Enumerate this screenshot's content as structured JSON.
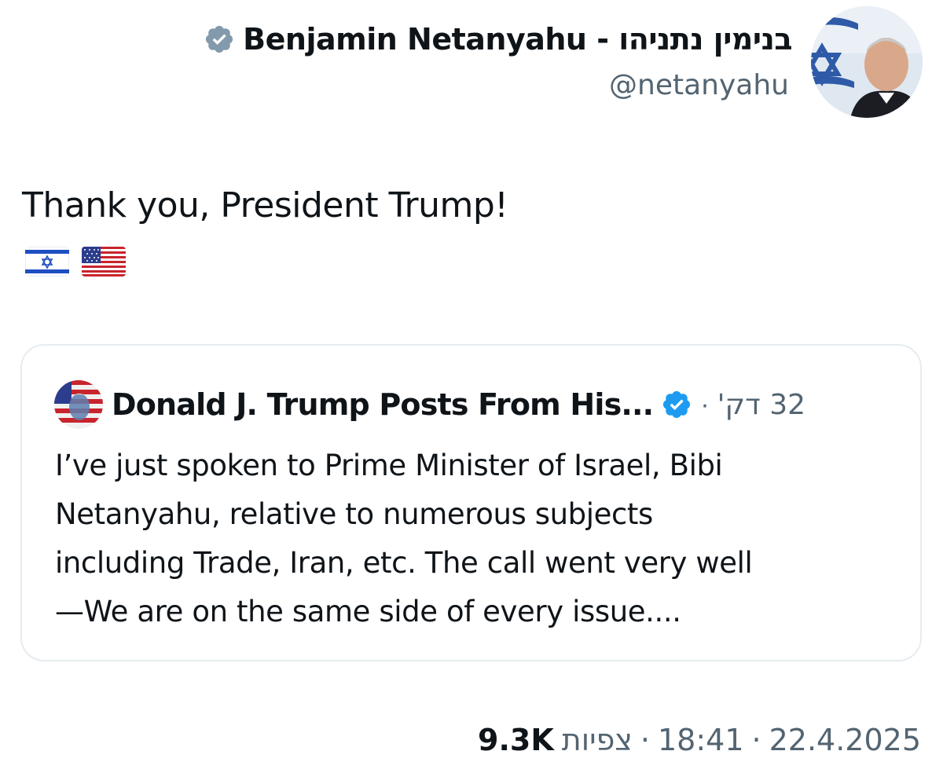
{
  "tweet": {
    "author": {
      "display_name": "Benjamin Netanyahu - בנימין נתניהו",
      "handle": "@netanyahu",
      "verified_badge_color": "#829aab"
    },
    "text": "Thank you, President Trump!",
    "emojis": [
      "israel-flag",
      "us-flag"
    ],
    "quoted": {
      "author_name": "Donald J. Trump Posts From His...",
      "verified_badge_color": "#1d9bf0",
      "separator": "·",
      "time_ago": "32 דק'",
      "lines": [
        "I’ve just spoken to Prime Minister of Israel, Bibi",
        "Netanyahu, relative to numerous subjects",
        "including Trade, Iran, etc. The call went very well",
        "—We are on the same side of every issue...."
      ]
    },
    "meta": {
      "date": "22.4.2025",
      "time": "18:41",
      "views_count": "9.3K",
      "views_label": "צפיות",
      "separator": "·"
    }
  }
}
